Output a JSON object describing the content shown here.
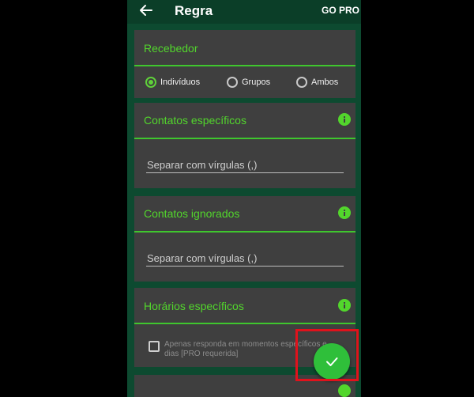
{
  "appbar": {
    "title": "Regra",
    "go_pro_label": "GO PRO"
  },
  "recebedor": {
    "title": "Recebedor",
    "options": [
      {
        "label": "Indivíduos",
        "selected": true
      },
      {
        "label": "Grupos",
        "selected": false
      },
      {
        "label": "Ambos",
        "selected": false
      }
    ]
  },
  "contatos_especificos": {
    "title": "Contatos específicos",
    "placeholder": "Separar com vírgulas (,)",
    "icon": "info-icon"
  },
  "contatos_ignorados": {
    "title": "Contatos ignorados",
    "placeholder": "Separar com vírgulas (,)",
    "icon": "info-icon"
  },
  "horarios_especificos": {
    "title": "Horários específicos",
    "checkbox_label": "Apenas responda em momentos específicos e dias [PRO requerida]",
    "checked": false,
    "icon": "info-icon"
  },
  "fab": {
    "icon": "check-icon"
  },
  "colors": {
    "accent": "#52d62c",
    "app_background": "#0d4a30",
    "card": "#3f3f3f",
    "fab": "#2fbf3a",
    "highlight": "#e0121c"
  }
}
